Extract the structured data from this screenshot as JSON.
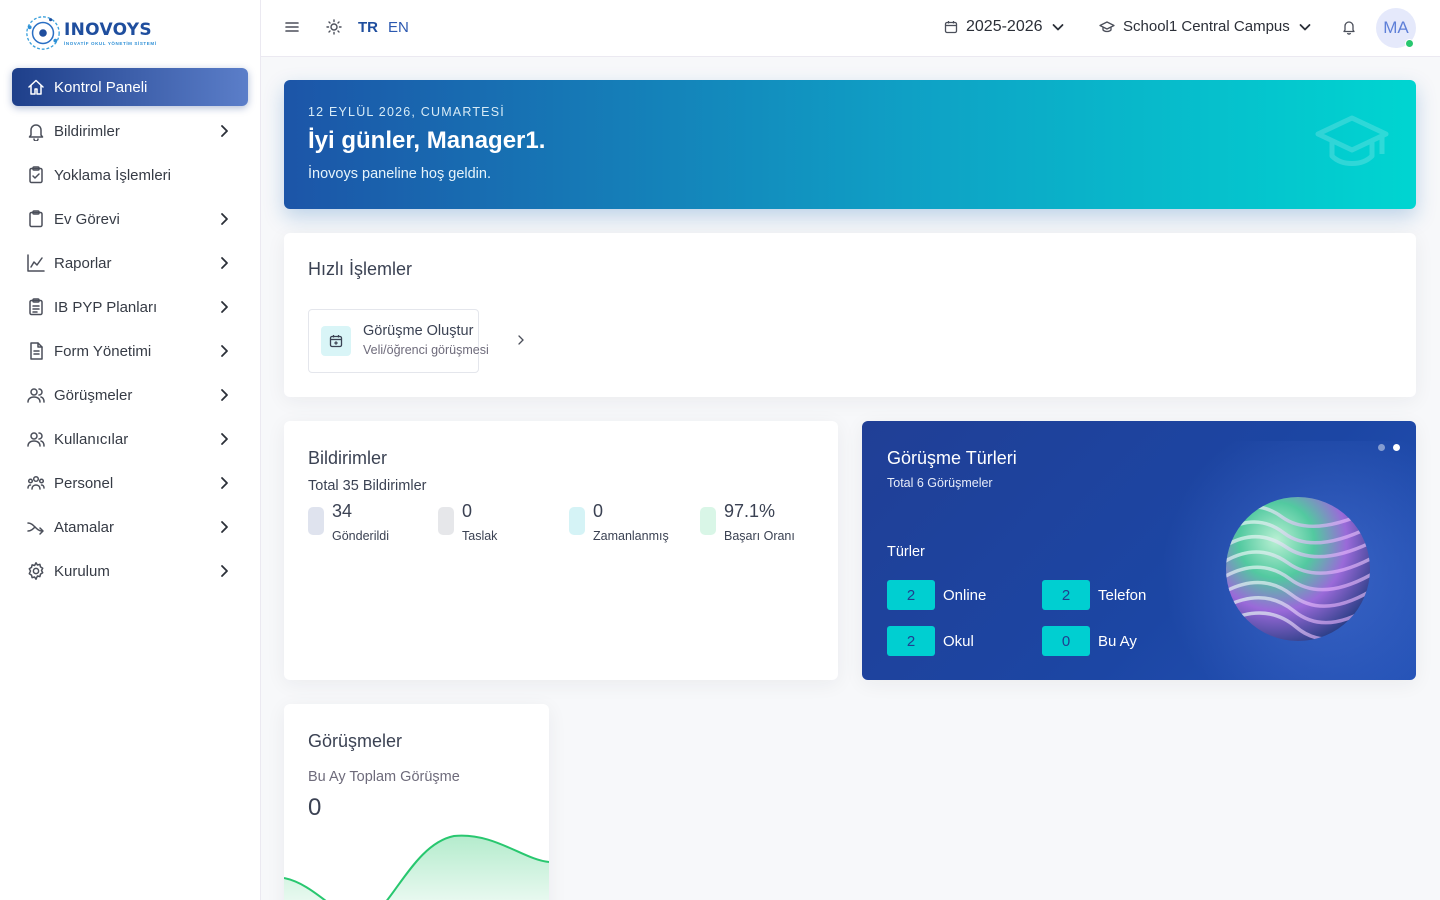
{
  "sidebar": {
    "logo": {
      "name": "INOVOYS",
      "tagline": "İNOVATİF OKUL YÖNETİM SİSTEMİ"
    },
    "items": [
      {
        "label": "Kontrol Paneli",
        "icon": "home-icon",
        "active": true,
        "has_children": false
      },
      {
        "label": "Bildirimler",
        "icon": "bell-icon",
        "active": false,
        "has_children": true
      },
      {
        "label": "Yoklama İşlemleri",
        "icon": "clipboard-check-icon",
        "active": false,
        "has_children": false
      },
      {
        "label": "Ev Görevi",
        "icon": "clipboard-icon",
        "active": false,
        "has_children": true
      },
      {
        "label": "Raporlar",
        "icon": "chart-icon",
        "active": false,
        "has_children": true
      },
      {
        "label": "IB PYP Planları",
        "icon": "clipboard-list-icon",
        "active": false,
        "has_children": true
      },
      {
        "label": "Form Yönetimi",
        "icon": "file-text-icon",
        "active": false,
        "has_children": true
      },
      {
        "label": "Görüşmeler",
        "icon": "users-icon",
        "active": false,
        "has_children": true
      },
      {
        "label": "Kullanıcılar",
        "icon": "users-icon",
        "active": false,
        "has_children": true
      },
      {
        "label": "Personel",
        "icon": "team-icon",
        "active": false,
        "has_children": true
      },
      {
        "label": "Atamalar",
        "icon": "assign-arrow-icon",
        "active": false,
        "has_children": true
      },
      {
        "label": "Kurulum",
        "icon": "settings-icon",
        "active": false,
        "has_children": true
      }
    ]
  },
  "topbar": {
    "lang_tr": "TR",
    "lang_en": "EN",
    "year": "2025-2026",
    "campus": "School1 Central Campus",
    "avatar_initials": "MA",
    "online_color": "#28c76f"
  },
  "welcome": {
    "date": "12 EYLÜL 2026, CUMARTESİ",
    "greeting": "İyi günler, Manager1.",
    "subtitle": "İnovoys paneline hoş geldin."
  },
  "quick_actions": {
    "title": "Hızlı İşlemler",
    "items": [
      {
        "title": "Görüşme Oluştur",
        "subtitle": "Veli/öğrenci görüşmesi",
        "icon": "calendar-plus-icon"
      }
    ]
  },
  "notifications": {
    "title": "Bildirimler",
    "total": "Total 35 Bildirimler",
    "stats": [
      {
        "value": "34",
        "label": "Gönderildi",
        "color": "#dfe3ee"
      },
      {
        "value": "0",
        "label": "Taslak",
        "color": "#e6e7ea"
      },
      {
        "value": "0",
        "label": "Zamanlanmış",
        "color": "#d5f3f6"
      },
      {
        "value": "97.1%",
        "label": "Başarı Oranı",
        "color": "#d9f6e7"
      }
    ]
  },
  "meeting_types": {
    "title": "Görüşme Türleri",
    "total": "Total 6 Görüşmeler",
    "section_label": "Türler",
    "active_slide": 2,
    "slide_count": 2,
    "types": [
      {
        "count": "2",
        "label": "Online"
      },
      {
        "count": "2",
        "label": "Telefon"
      },
      {
        "count": "2",
        "label": "Okul"
      },
      {
        "count": "0",
        "label": "Bu Ay"
      }
    ]
  },
  "meetings": {
    "title": "Görüşmeler",
    "subtitle": "Bu Ay Toplam Görüşme",
    "value": "0",
    "line_color": "#28c76f"
  }
}
